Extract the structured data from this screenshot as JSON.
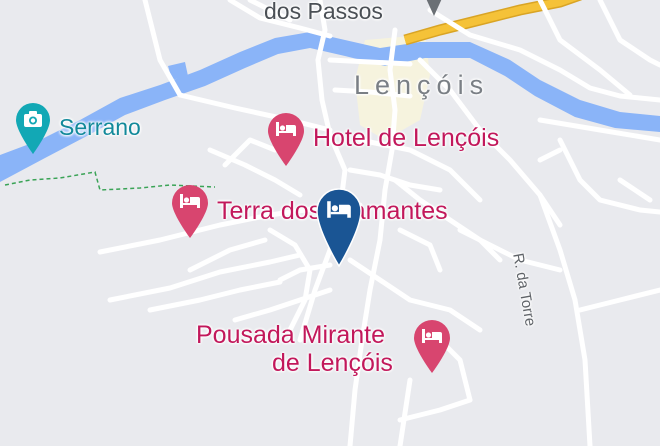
{
  "map": {
    "colors": {
      "land": "#e9eaee",
      "road": "#ffffff",
      "river": "#8ab4f8",
      "highway": "#f5c238",
      "urban": "#f6f3de",
      "hotel_pin": "#d8456f",
      "selected_pin": "#1a5594",
      "attraction": "#12a8b5",
      "trail": "#3aa356"
    },
    "labels": {
      "top_place": "dos Passos",
      "town": "Lençóis",
      "street": "R. da Torre"
    },
    "attraction": {
      "label": "Serrano",
      "icon": "camera-icon"
    },
    "hotels": [
      {
        "label": "Hotel de Lençóis",
        "icon": "bed-icon"
      },
      {
        "label": "Terra dos Diamantes",
        "icon": "bed-icon"
      },
      {
        "line1": "Pousada Mirante",
        "line2": "de Lençóis",
        "icon": "bed-icon"
      }
    ],
    "selected": {
      "icon": "bed-icon"
    }
  }
}
